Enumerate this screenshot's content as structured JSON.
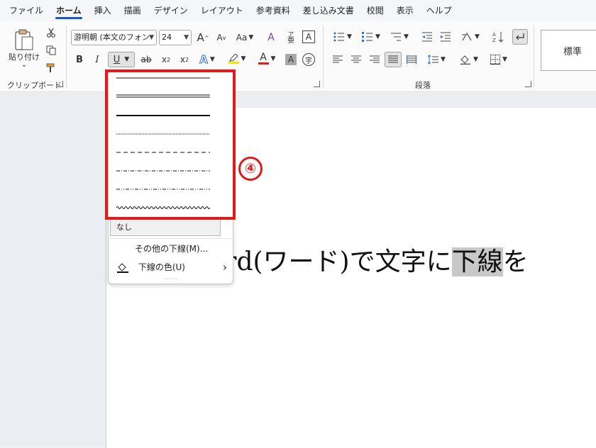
{
  "menu": {
    "tabs": [
      "ファイル",
      "ホーム",
      "挿入",
      "描画",
      "デザイン",
      "レイアウト",
      "参考資料",
      "差し込み文書",
      "校閲",
      "表示",
      "ヘルプ"
    ],
    "active": "ホーム"
  },
  "ribbon": {
    "clipboard": {
      "paste_label": "貼り付け",
      "paste_arrow": "⌄",
      "group_label": "クリップボード"
    },
    "font": {
      "font_name": "游明朝 (本文のフォン",
      "font_size": "24",
      "grow_icon": "A",
      "shrink_icon": "A",
      "case_label": "Aa",
      "clear_icon": "A",
      "furigana_top": "ア",
      "furigana_bottom": "亜",
      "border_char": "A",
      "bold": "B",
      "italic": "I",
      "underline": "U",
      "strike": "ab",
      "subscript_base": "x",
      "subscript_mark": "2",
      "superscript_base": "x",
      "superscript_mark": "2",
      "effects_char": "A",
      "font_color_char": "A",
      "shade_char": "A",
      "enclose_char": "字",
      "highlight_color": "#f5e400",
      "font_color": "#e01b1b"
    },
    "paragraph": {
      "group_label": "段落"
    },
    "styles": {
      "normal": "標準"
    }
  },
  "document": {
    "text_before": "Word(ワード)で文字に",
    "selected_text": "下線",
    "text_after": "を"
  },
  "underline_menu": {
    "styles": [
      "single",
      "double",
      "thick",
      "dotted",
      "dashed",
      "dash-dot",
      "dash-dot-dot",
      "wave"
    ],
    "none_label": "なし",
    "more_label": "その他の下線(M)...",
    "color_label": "下線の色(U)",
    "submenu_arrow": "›",
    "grip": "⋯⋯"
  },
  "annotation": {
    "marker": "④",
    "color": "#e01b1b"
  }
}
